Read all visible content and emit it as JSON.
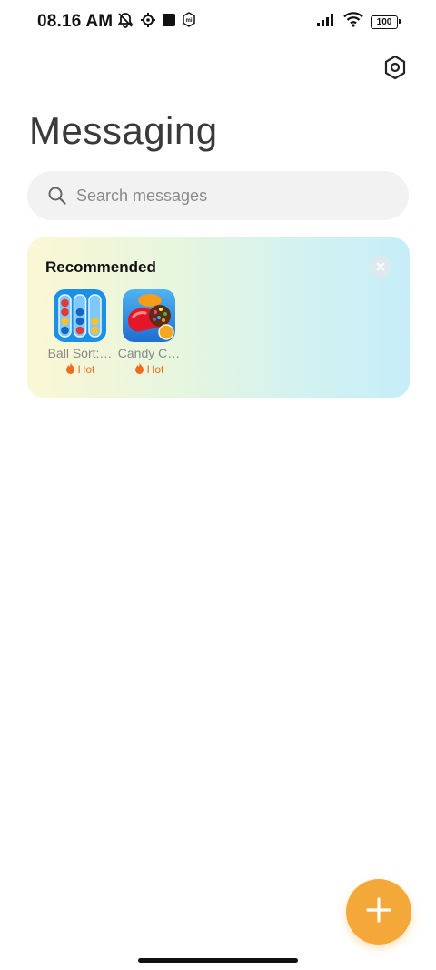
{
  "status_bar": {
    "time": "08.16 AM",
    "battery": "100",
    "icons_left": [
      "mute-bell-icon",
      "gear-sync-icon",
      "square-app-icon",
      "mi-shield-icon"
    ],
    "icons_right": [
      "signal-icon",
      "wifi-icon",
      "battery-icon"
    ]
  },
  "header": {
    "title": "Messaging",
    "settings_icon": "settings-hex-icon"
  },
  "search": {
    "placeholder": "Search messages"
  },
  "recommended": {
    "title": "Recommended",
    "close_icon": "close-icon",
    "apps": [
      {
        "name": "Ball Sort:…",
        "badge": "Hot",
        "icon": "ball-sort-app-icon"
      },
      {
        "name": "Candy C…",
        "badge": "Hot",
        "icon": "candy-crush-app-icon"
      }
    ]
  },
  "fab": {
    "icon": "plus-icon"
  },
  "colors": {
    "accent": "#f5a83a",
    "hot": "#f26b1d",
    "search_bg": "#f2f2f2"
  }
}
